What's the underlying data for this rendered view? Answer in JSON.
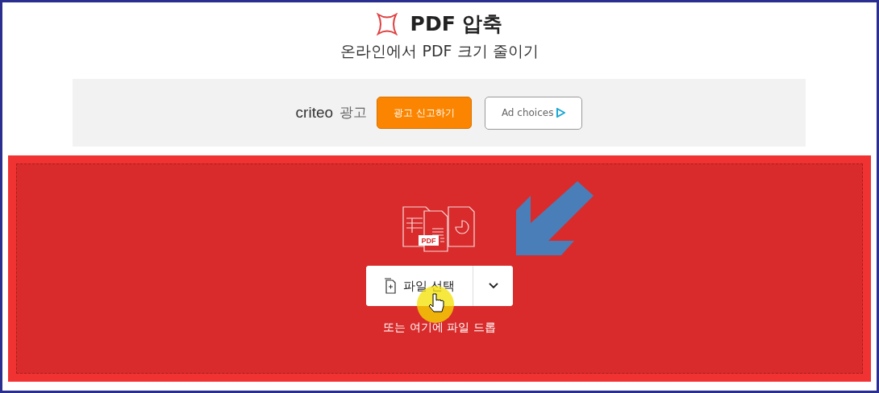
{
  "header": {
    "title": "PDF 압축",
    "subtitle": "온라인에서 PDF 크기 줄이기"
  },
  "ad": {
    "brand": "criteo",
    "label": "광고",
    "report_button": "광고 신고하기",
    "choices_button": "Ad choices"
  },
  "dropzone": {
    "illustration_label": "PDF",
    "select_button": "파일 선택",
    "hint": "또는 여기에 파일 드롭"
  }
}
